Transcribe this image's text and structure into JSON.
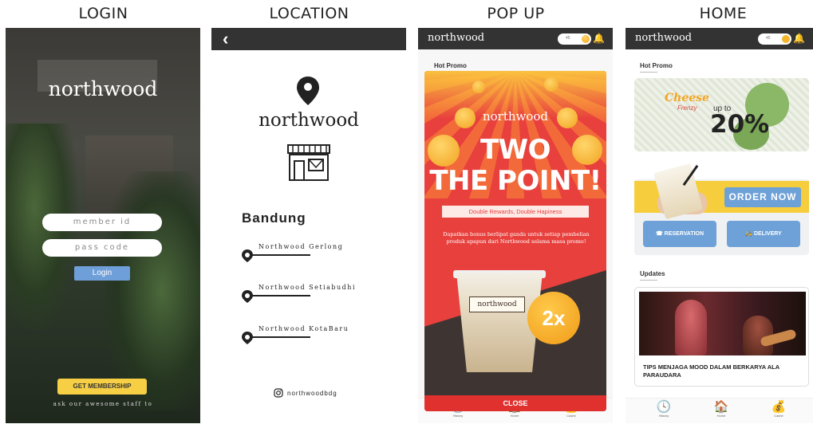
{
  "headings": [
    "LOGIN",
    "LOCATION",
    "POP UP",
    "HOME"
  ],
  "login": {
    "logo": "northwood",
    "member_placeholder": "member id",
    "pass_placeholder": "pass code",
    "login_label": "Login",
    "membership_label": "GET MEMBERSHIP",
    "hint": "ask our awesome staff to"
  },
  "location": {
    "back_icon": "chevron-left-icon",
    "logo": "northwood",
    "city": "Bandung",
    "locations": [
      "Northwood Gerlong",
      "Northwood Setiabudhi",
      "Northwood KotaBaru"
    ],
    "instagram": "northwoodbdg"
  },
  "popup": {
    "brand": "northwood",
    "toggle_value": "45",
    "section": "Hot Promo",
    "card_brand": "northwood",
    "title_line1": "TWO",
    "title_line2": "THE POINT!",
    "ribbon": "Double Rewards, Double Hapiness",
    "desc": "Dapatkan bonus berlipat ganda untuk setiap pembelian produk apapun dari Northwood selama masa promo!",
    "cup_label": "northwood",
    "badge": "2x",
    "close_label": "CLOSE",
    "nav": [
      "History",
      "Home",
      "Cashe"
    ]
  },
  "home": {
    "brand": "northwood",
    "toggle_value": "45",
    "promo_section": "Hot Promo",
    "promo_cheese": "Cheese",
    "promo_frenzy": "Frenzy",
    "promo_upto": "up to",
    "promo_pct": "20%",
    "order_label": "ORDER NOW",
    "reservation_label": "RESERVATION",
    "delivery_label": "DELIVERY",
    "updates_section": "Updates",
    "update_title": "TIPS MENJAGA MOOD DALAM BERKARYA ALA PARAUDARA",
    "nav": [
      "History",
      "Home",
      "Cashe"
    ]
  },
  "colors": {
    "accent_blue": "#6f9fd8",
    "accent_yellow": "#f6cf45",
    "popup_red": "#e8403d",
    "dark_header": "#333333"
  }
}
